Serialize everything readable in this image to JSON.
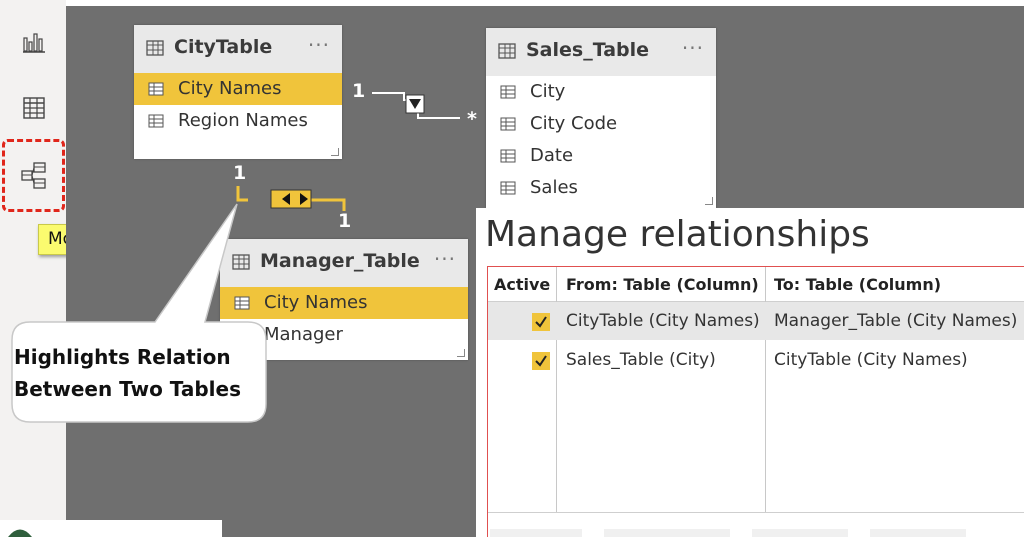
{
  "sidebar": {
    "items": [
      {
        "icon": "report-icon",
        "label": ""
      },
      {
        "icon": "data-icon",
        "label": ""
      },
      {
        "icon": "model-icon",
        "label": ""
      }
    ],
    "tooltip": "Model"
  },
  "tables": {
    "city": {
      "title": "CityTable",
      "more": "···",
      "fields": [
        "City Names",
        "Region Names"
      ]
    },
    "sales": {
      "title": "Sales_Table",
      "more": "···",
      "fields": [
        "City",
        "City Code",
        "Date",
        "Sales"
      ]
    },
    "manager": {
      "title": "Manager_Table",
      "more": "···",
      "fields": [
        "City Names",
        "Manager"
      ]
    }
  },
  "relationships_diagram": {
    "city_sales": {
      "from_card": "1",
      "to_card": "*"
    },
    "city_manager": {
      "from_card": "1",
      "to_card": "1"
    }
  },
  "callout": {
    "line1": "Highlights Relation",
    "line2": "Between Two Tables"
  },
  "manage_relationships": {
    "title": "Manage relationships",
    "columns": [
      "Active",
      "From: Table (Column)",
      "To: Table (Column)"
    ],
    "rows": [
      {
        "active": true,
        "from": "CityTable (City Names)",
        "to": "Manager_Table (City Names)"
      },
      {
        "active": true,
        "from": "Sales_Table (City)",
        "to": "CityTable (City Names)"
      }
    ]
  },
  "colors": {
    "accent": "#f0c43b",
    "canvas": "#6f6f6f",
    "highlight_border": "#e0261b",
    "tooltip": "#fbfb6f"
  }
}
